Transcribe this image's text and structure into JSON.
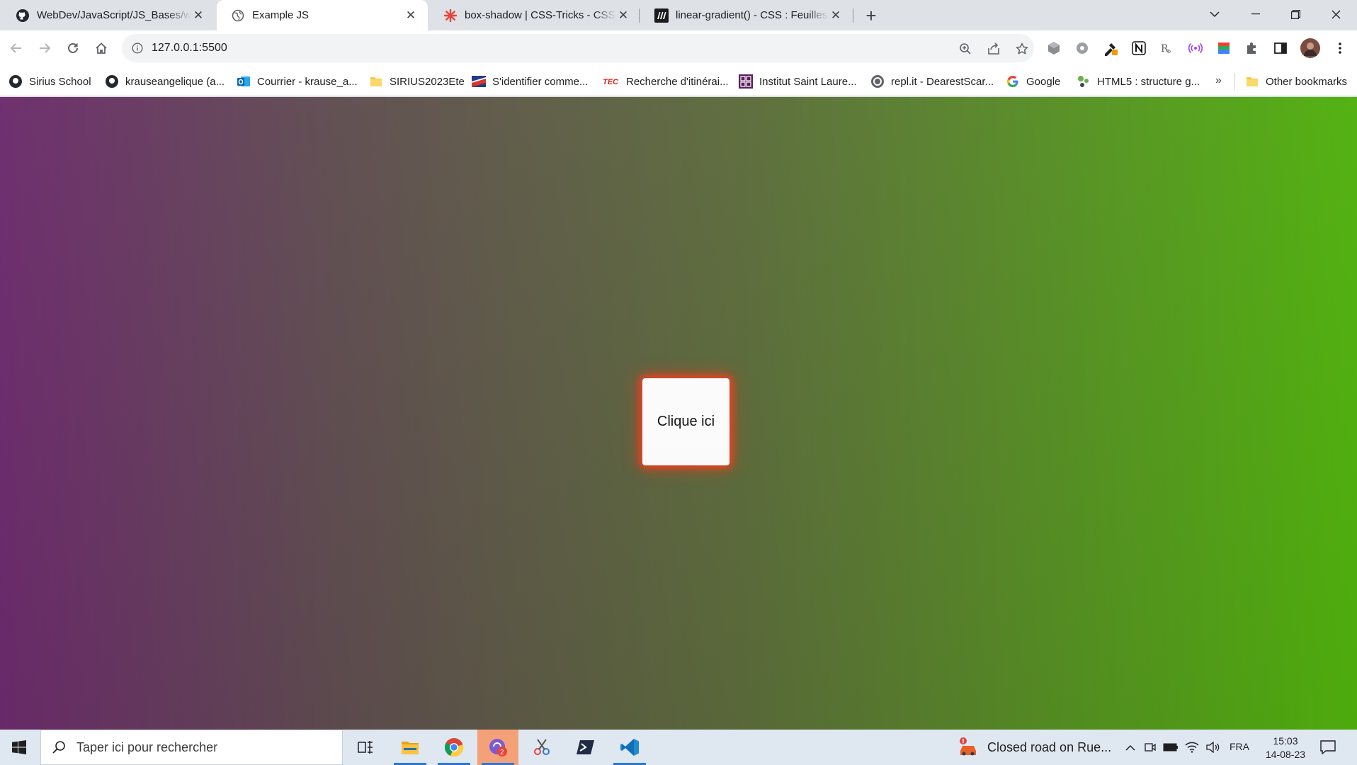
{
  "tabs": [
    {
      "title": "WebDev/JavaScript/JS_Bases/win",
      "icon": "github-icon"
    },
    {
      "title": "Example JS",
      "icon": "globe-icon",
      "active": true
    },
    {
      "title": "box-shadow | CSS-Tricks - CSS-Tr",
      "icon": "css-tricks-icon"
    },
    {
      "title": "linear-gradient() - CSS : Feuilles d",
      "icon": "mdn-icon"
    }
  ],
  "toolbar": {
    "url": "127.0.0.1:5500"
  },
  "bookmarks": [
    {
      "label": "Sirius School",
      "icon": "github-icon"
    },
    {
      "label": "krauseangelique (a...",
      "icon": "github-icon"
    },
    {
      "label": "Courrier - krause_a...",
      "icon": "outlook-icon"
    },
    {
      "label": "SIRIUS2023Ete",
      "icon": "folder-icon"
    },
    {
      "label": "S'identifier comme...",
      "icon": "flag-icon"
    },
    {
      "label": "Recherche d'itinérai...",
      "icon": "tec-icon"
    },
    {
      "label": "Institut Saint Laure...",
      "icon": "institute-icon"
    },
    {
      "label": "repl.it - DearestScar...",
      "icon": "replit-icon"
    },
    {
      "label": "Google",
      "icon": "google-icon"
    },
    {
      "label": "HTML5 : structure g...",
      "icon": "html5-icon"
    }
  ],
  "bookmarks_overflow": "»",
  "other_bookmarks": "Other bookmarks",
  "page": {
    "button_label": "Clique ici",
    "gradient_start": "#6b2a6b",
    "gradient_end": "#4fb00c",
    "shadow_color": "#ff3a1c"
  },
  "taskbar": {
    "search_placeholder": "Taper ici pour rechercher",
    "news": "Closed road on Rue...",
    "language": "FRA",
    "time": "15:03",
    "date": "14-08-23",
    "copilot_badge": "2"
  }
}
